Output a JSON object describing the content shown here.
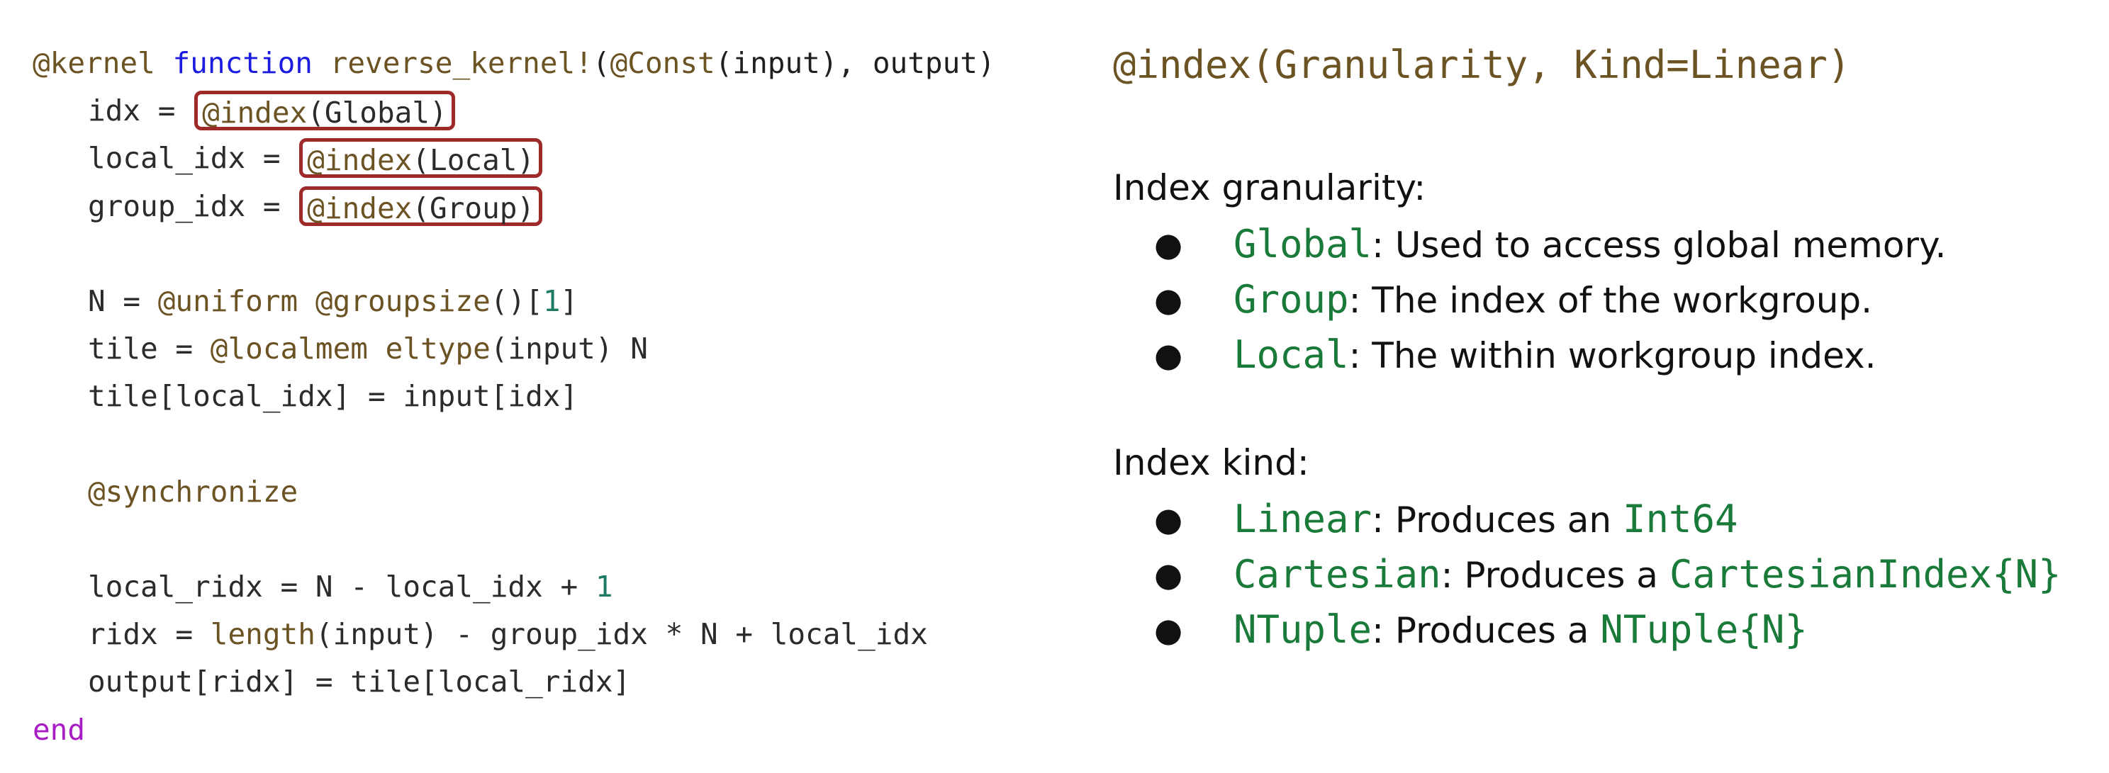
{
  "code": {
    "l1": {
      "macro": "@kernel",
      "kw": "function",
      "fname": "reverse_kernel!",
      "open": "(",
      "const_macro": "@Const",
      "rest": "(input), output)"
    },
    "l2": {
      "prefix": "idx = ",
      "macro": "@index",
      "arg": "(Global)"
    },
    "l3": {
      "prefix": "local_idx = ",
      "macro": "@index",
      "arg": "(Local)"
    },
    "l4": {
      "prefix": "group_idx = ",
      "macro": "@index",
      "arg": "(Group)"
    },
    "l6": {
      "prefix": "N = ",
      "m1": "@uniform",
      "m2": "@groupsize",
      "mid": "()[",
      "num": "1",
      "close": "]"
    },
    "l7": {
      "prefix": "tile = ",
      "macro": "@localmem",
      "fn": "eltype",
      "rest": "(input) N"
    },
    "l8": {
      "text": "tile[local_idx] = input[idx]"
    },
    "l10": {
      "macro": "@synchronize"
    },
    "l12": {
      "prefix": "local_ridx = N - local_idx + ",
      "num": "1"
    },
    "l13": {
      "prefix": "ridx = ",
      "fn": "length",
      "rest": "(input) - group_idx * N + local_idx"
    },
    "l14": {
      "text": "output[ridx] = tile[local_ridx]"
    },
    "l15": {
      "kw": "end"
    }
  },
  "docs": {
    "signature": "@index(Granularity, Kind=Linear)",
    "granularity": {
      "title": "Index granularity:",
      "items": [
        {
          "name": "Global",
          "desc": ": Used to access global memory."
        },
        {
          "name": "Group",
          "desc": ": The index of the workgroup."
        },
        {
          "name": "Local",
          "desc": ": The within workgroup index."
        }
      ]
    },
    "kind": {
      "title": "Index kind:",
      "items": [
        {
          "name": "Linear",
          "desc": ": Produces an ",
          "type": "Int64"
        },
        {
          "name": "Cartesian",
          "desc": ": Produces a ",
          "type": "CartesianIndex{N}"
        },
        {
          "name": "NTuple",
          "desc": ": Produces a ",
          "type": "NTuple{N}"
        }
      ]
    },
    "bullet": "●"
  },
  "colors": {
    "macro": "#6b5324",
    "keyword": "#1c1ce0",
    "number": "#1e7a64",
    "end_keyword": "#a81cc4",
    "highlight_box": "#9e2a2a",
    "doc_identifier": "#1a7a3a"
  }
}
